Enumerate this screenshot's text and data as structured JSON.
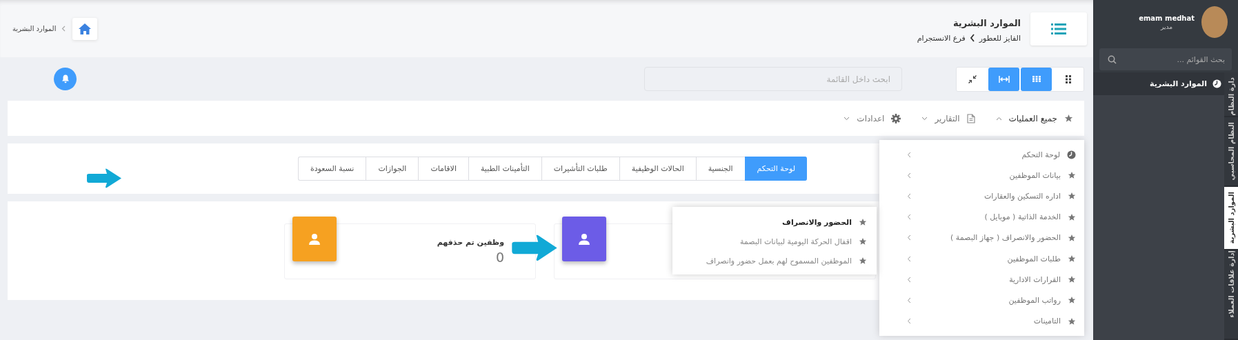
{
  "header": {
    "title": "الموارد البشرية",
    "breadcrumb": [
      "الفايز للعطور",
      "فرع الانستجرام"
    ],
    "home_crumb": "الموارد البشرية"
  },
  "toolbar": {
    "view_buttons": [
      {
        "kind": "dots",
        "selected": false
      },
      {
        "kind": "grid",
        "selected": true
      },
      {
        "kind": "expand",
        "selected": true
      },
      {
        "kind": "compress",
        "selected": false
      }
    ],
    "search": {
      "placeholder": "ابحث داخل القائمة"
    }
  },
  "menu_bar": [
    {
      "label": "جميع العمليات",
      "kind": "star",
      "expanded": true
    },
    {
      "label": "التقارير",
      "kind": "document",
      "expanded": false
    },
    {
      "label": "اعدادات",
      "kind": "gear",
      "expanded": false
    }
  ],
  "tabs": [
    {
      "label": "لوحة التحكم",
      "selected": true
    },
    {
      "label": "الجنسية",
      "selected": false
    },
    {
      "label": "الحالات الوظيفية",
      "selected": false
    },
    {
      "label": "طلبات التأشيرات",
      "selected": false
    },
    {
      "label": "التأمينات الطبية",
      "selected": false
    },
    {
      "label": "الاقامات",
      "selected": false
    },
    {
      "label": "الجوازات",
      "selected": false
    },
    {
      "label": "نسبة السعودة",
      "selected": false
    }
  ],
  "stat_cards": [
    {
      "color": "#6c5ce7"
    },
    {
      "label": "وظفين تم حذفهم",
      "value": "0",
      "color": "#f6a121"
    }
  ],
  "operations_menu": [
    {
      "label": "لوحة التحكم",
      "kind": "dashboard"
    },
    {
      "label": "بيانات الموظفين",
      "kind": "star"
    },
    {
      "label": "اداره التسكين والعقارات",
      "kind": "star"
    },
    {
      "label": "الخدمة الذاتية ( موبايل )",
      "kind": "star"
    },
    {
      "label": "الحضور والانصراف ( جهاز البصمة )",
      "kind": "star"
    },
    {
      "label": "طلبات الموظفين",
      "kind": "star"
    },
    {
      "label": "القرارات الادارية",
      "kind": "star"
    },
    {
      "label": "رواتب الموظفين",
      "kind": "star"
    },
    {
      "label": "التامينات",
      "kind": "star"
    }
  ],
  "submenu": [
    {
      "label": "الحضور والانصراف",
      "selected": true
    },
    {
      "label": "اقفال الحركة اليومية لبيانات البصمة",
      "selected": false
    },
    {
      "label": "الموظفين المسموح لهم بعمل حضور وانصراف",
      "selected": false
    }
  ],
  "sidebar": {
    "user": {
      "name": "emam medhat",
      "role": "مدير"
    },
    "search": {
      "placeholder": "بحث القوائم ..."
    },
    "items": [
      {
        "label": "الموارد البشرية"
      }
    ],
    "vertical_tabs": [
      {
        "label": "دارة النظام",
        "selected": false
      },
      {
        "label": "النظام المحاسبي",
        "selected": false
      },
      {
        "label": "الموارد البشرية",
        "selected": true
      },
      {
        "label": "إدارة علاقات العملاء",
        "selected": false
      }
    ]
  }
}
